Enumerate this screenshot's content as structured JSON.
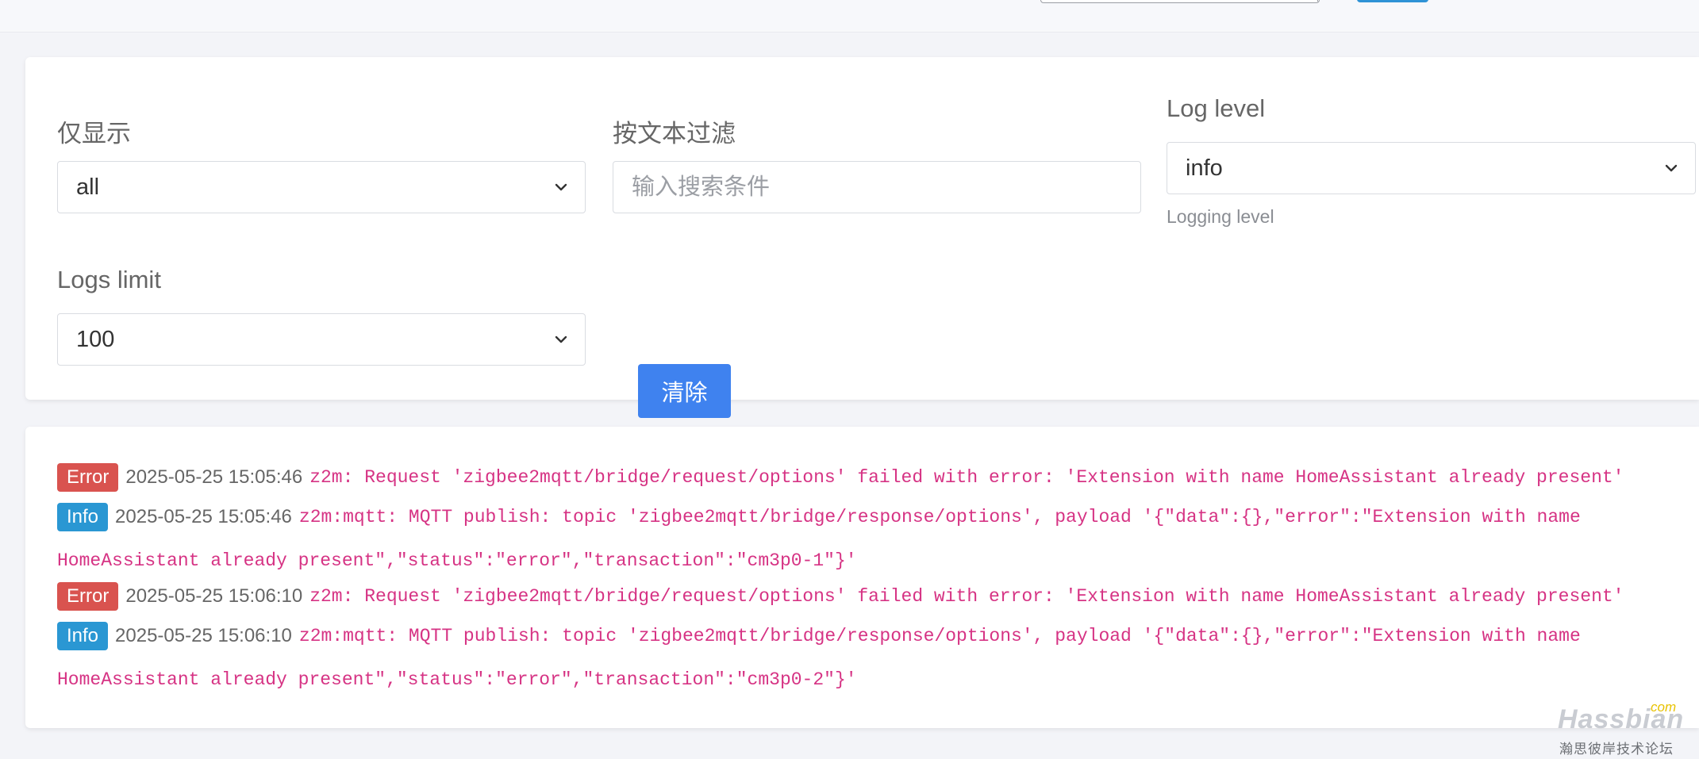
{
  "filters": {
    "show_only": {
      "label": "仅显示",
      "value": "all"
    },
    "text_filter": {
      "label": "按文本过滤",
      "placeholder": "输入搜索条件"
    },
    "log_level": {
      "label": "Log level",
      "value": "info",
      "help": "Logging level"
    },
    "logs_limit": {
      "label": "Logs limit",
      "value": "100"
    },
    "clear_label": "清除"
  },
  "logs": [
    {
      "level": "Error",
      "timestamp": "2025-05-25 15:05:46",
      "message": "z2m: Request 'zigbee2mqtt/bridge/request/options' failed with error: 'Extension with name HomeAssistant already present'",
      "continuation": ""
    },
    {
      "level": "Info",
      "timestamp": "2025-05-25 15:05:46",
      "message": "z2m:mqtt: MQTT publish: topic 'zigbee2mqtt/bridge/response/options', payload '{\"data\":{},\"error\":\"Extension with name",
      "continuation": "HomeAssistant already present\",\"status\":\"error\",\"transaction\":\"cm3p0-1\"}'"
    },
    {
      "level": "Error",
      "timestamp": "2025-05-25 15:06:10",
      "message": "z2m: Request 'zigbee2mqtt/bridge/request/options' failed with error: 'Extension with name HomeAssistant already present'",
      "continuation": ""
    },
    {
      "level": "Info",
      "timestamp": "2025-05-25 15:06:10",
      "message": "z2m:mqtt: MQTT publish: topic 'zigbee2mqtt/bridge/response/options', payload '{\"data\":{},\"error\":\"Extension with name",
      "continuation": "HomeAssistant already present\",\"status\":\"error\",\"transaction\":\"cm3p0-2\"}'"
    }
  ],
  "watermark": {
    "brand": "Hassbian",
    "suffix": "com",
    "subtitle": "瀚思彼岸技术论坛"
  },
  "colors": {
    "error_badge": "#d9534f",
    "info_badge": "#2a97d3",
    "primary_button": "#3f82ef",
    "log_message": "#d63384"
  }
}
